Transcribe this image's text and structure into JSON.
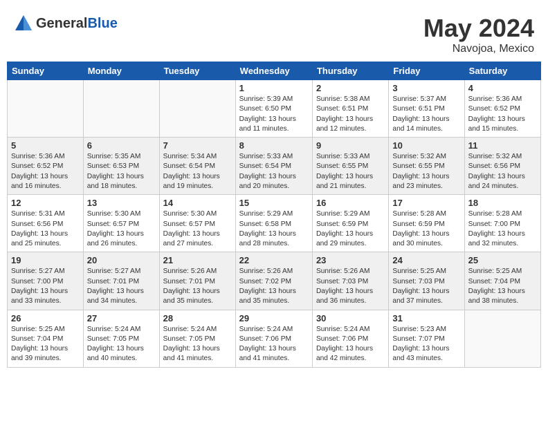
{
  "header": {
    "logo_general": "General",
    "logo_blue": "Blue",
    "month_year": "May 2024",
    "location": "Navojoa, Mexico"
  },
  "days_of_week": [
    "Sunday",
    "Monday",
    "Tuesday",
    "Wednesday",
    "Thursday",
    "Friday",
    "Saturday"
  ],
  "weeks": [
    [
      {
        "num": "",
        "sunrise": "",
        "sunset": "",
        "daylight": ""
      },
      {
        "num": "",
        "sunrise": "",
        "sunset": "",
        "daylight": ""
      },
      {
        "num": "",
        "sunrise": "",
        "sunset": "",
        "daylight": ""
      },
      {
        "num": "1",
        "sunrise": "Sunrise: 5:39 AM",
        "sunset": "Sunset: 6:50 PM",
        "daylight": "Daylight: 13 hours and 11 minutes."
      },
      {
        "num": "2",
        "sunrise": "Sunrise: 5:38 AM",
        "sunset": "Sunset: 6:51 PM",
        "daylight": "Daylight: 13 hours and 12 minutes."
      },
      {
        "num": "3",
        "sunrise": "Sunrise: 5:37 AM",
        "sunset": "Sunset: 6:51 PM",
        "daylight": "Daylight: 13 hours and 14 minutes."
      },
      {
        "num": "4",
        "sunrise": "Sunrise: 5:36 AM",
        "sunset": "Sunset: 6:52 PM",
        "daylight": "Daylight: 13 hours and 15 minutes."
      }
    ],
    [
      {
        "num": "5",
        "sunrise": "Sunrise: 5:36 AM",
        "sunset": "Sunset: 6:52 PM",
        "daylight": "Daylight: 13 hours and 16 minutes."
      },
      {
        "num": "6",
        "sunrise": "Sunrise: 5:35 AM",
        "sunset": "Sunset: 6:53 PM",
        "daylight": "Daylight: 13 hours and 18 minutes."
      },
      {
        "num": "7",
        "sunrise": "Sunrise: 5:34 AM",
        "sunset": "Sunset: 6:54 PM",
        "daylight": "Daylight: 13 hours and 19 minutes."
      },
      {
        "num": "8",
        "sunrise": "Sunrise: 5:33 AM",
        "sunset": "Sunset: 6:54 PM",
        "daylight": "Daylight: 13 hours and 20 minutes."
      },
      {
        "num": "9",
        "sunrise": "Sunrise: 5:33 AM",
        "sunset": "Sunset: 6:55 PM",
        "daylight": "Daylight: 13 hours and 21 minutes."
      },
      {
        "num": "10",
        "sunrise": "Sunrise: 5:32 AM",
        "sunset": "Sunset: 6:55 PM",
        "daylight": "Daylight: 13 hours and 23 minutes."
      },
      {
        "num": "11",
        "sunrise": "Sunrise: 5:32 AM",
        "sunset": "Sunset: 6:56 PM",
        "daylight": "Daylight: 13 hours and 24 minutes."
      }
    ],
    [
      {
        "num": "12",
        "sunrise": "Sunrise: 5:31 AM",
        "sunset": "Sunset: 6:56 PM",
        "daylight": "Daylight: 13 hours and 25 minutes."
      },
      {
        "num": "13",
        "sunrise": "Sunrise: 5:30 AM",
        "sunset": "Sunset: 6:57 PM",
        "daylight": "Daylight: 13 hours and 26 minutes."
      },
      {
        "num": "14",
        "sunrise": "Sunrise: 5:30 AM",
        "sunset": "Sunset: 6:57 PM",
        "daylight": "Daylight: 13 hours and 27 minutes."
      },
      {
        "num": "15",
        "sunrise": "Sunrise: 5:29 AM",
        "sunset": "Sunset: 6:58 PM",
        "daylight": "Daylight: 13 hours and 28 minutes."
      },
      {
        "num": "16",
        "sunrise": "Sunrise: 5:29 AM",
        "sunset": "Sunset: 6:59 PM",
        "daylight": "Daylight: 13 hours and 29 minutes."
      },
      {
        "num": "17",
        "sunrise": "Sunrise: 5:28 AM",
        "sunset": "Sunset: 6:59 PM",
        "daylight": "Daylight: 13 hours and 30 minutes."
      },
      {
        "num": "18",
        "sunrise": "Sunrise: 5:28 AM",
        "sunset": "Sunset: 7:00 PM",
        "daylight": "Daylight: 13 hours and 32 minutes."
      }
    ],
    [
      {
        "num": "19",
        "sunrise": "Sunrise: 5:27 AM",
        "sunset": "Sunset: 7:00 PM",
        "daylight": "Daylight: 13 hours and 33 minutes."
      },
      {
        "num": "20",
        "sunrise": "Sunrise: 5:27 AM",
        "sunset": "Sunset: 7:01 PM",
        "daylight": "Daylight: 13 hours and 34 minutes."
      },
      {
        "num": "21",
        "sunrise": "Sunrise: 5:26 AM",
        "sunset": "Sunset: 7:01 PM",
        "daylight": "Daylight: 13 hours and 35 minutes."
      },
      {
        "num": "22",
        "sunrise": "Sunrise: 5:26 AM",
        "sunset": "Sunset: 7:02 PM",
        "daylight": "Daylight: 13 hours and 35 minutes."
      },
      {
        "num": "23",
        "sunrise": "Sunrise: 5:26 AM",
        "sunset": "Sunset: 7:03 PM",
        "daylight": "Daylight: 13 hours and 36 minutes."
      },
      {
        "num": "24",
        "sunrise": "Sunrise: 5:25 AM",
        "sunset": "Sunset: 7:03 PM",
        "daylight": "Daylight: 13 hours and 37 minutes."
      },
      {
        "num": "25",
        "sunrise": "Sunrise: 5:25 AM",
        "sunset": "Sunset: 7:04 PM",
        "daylight": "Daylight: 13 hours and 38 minutes."
      }
    ],
    [
      {
        "num": "26",
        "sunrise": "Sunrise: 5:25 AM",
        "sunset": "Sunset: 7:04 PM",
        "daylight": "Daylight: 13 hours and 39 minutes."
      },
      {
        "num": "27",
        "sunrise": "Sunrise: 5:24 AM",
        "sunset": "Sunset: 7:05 PM",
        "daylight": "Daylight: 13 hours and 40 minutes."
      },
      {
        "num": "28",
        "sunrise": "Sunrise: 5:24 AM",
        "sunset": "Sunset: 7:05 PM",
        "daylight": "Daylight: 13 hours and 41 minutes."
      },
      {
        "num": "29",
        "sunrise": "Sunrise: 5:24 AM",
        "sunset": "Sunset: 7:06 PM",
        "daylight": "Daylight: 13 hours and 41 minutes."
      },
      {
        "num": "30",
        "sunrise": "Sunrise: 5:24 AM",
        "sunset": "Sunset: 7:06 PM",
        "daylight": "Daylight: 13 hours and 42 minutes."
      },
      {
        "num": "31",
        "sunrise": "Sunrise: 5:23 AM",
        "sunset": "Sunset: 7:07 PM",
        "daylight": "Daylight: 13 hours and 43 minutes."
      },
      {
        "num": "",
        "sunrise": "",
        "sunset": "",
        "daylight": ""
      }
    ]
  ]
}
